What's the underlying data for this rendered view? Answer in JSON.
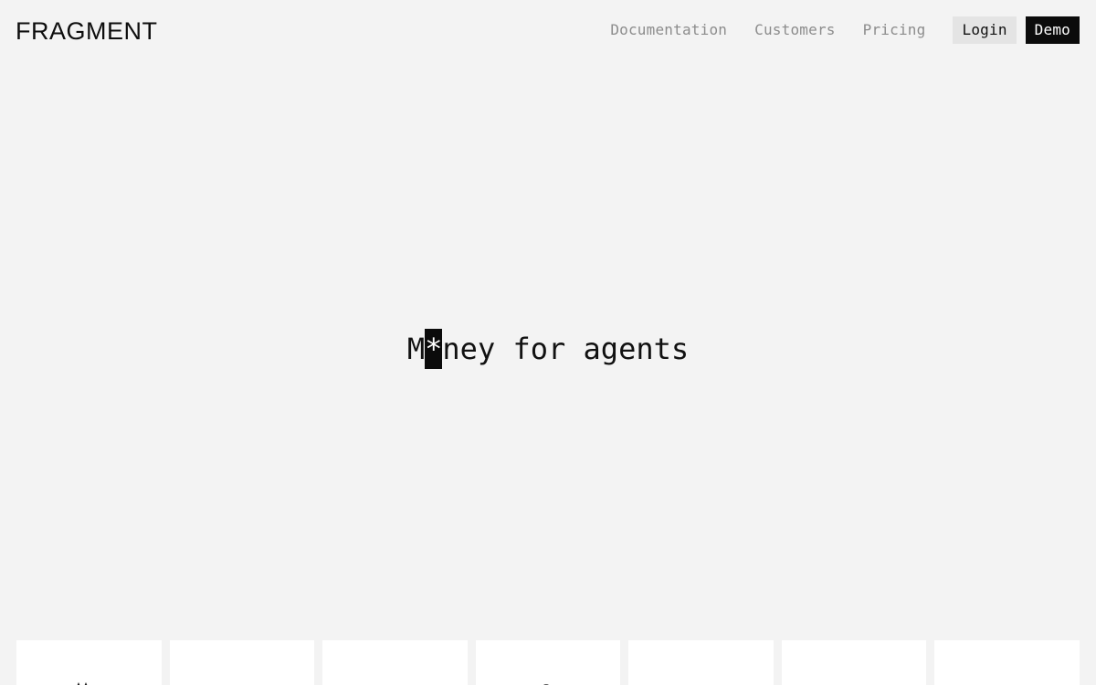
{
  "header": {
    "logo": "FRAGMENT",
    "nav": [
      {
        "label": "Documentation"
      },
      {
        "label": "Customers"
      },
      {
        "label": "Pricing"
      }
    ],
    "login_label": "Login",
    "demo_label": "Demo"
  },
  "hero": {
    "title_before": "M",
    "title_cursor": "*",
    "title_after": "ney for agents"
  },
  "logos": {
    "count_visible": 7,
    "items": [
      "customer-logo",
      "customer-logo",
      "customer-logo",
      "customer-logo",
      "customer-logo",
      "customer-logo",
      "customer-logo"
    ]
  },
  "colors": {
    "background": "#f3f3f3",
    "text": "#111111",
    "nav_muted": "#8c8c8c",
    "login_bg": "#e4e4e4",
    "demo_bg": "#0b0b0b",
    "tile_bg": "#ffffff"
  }
}
